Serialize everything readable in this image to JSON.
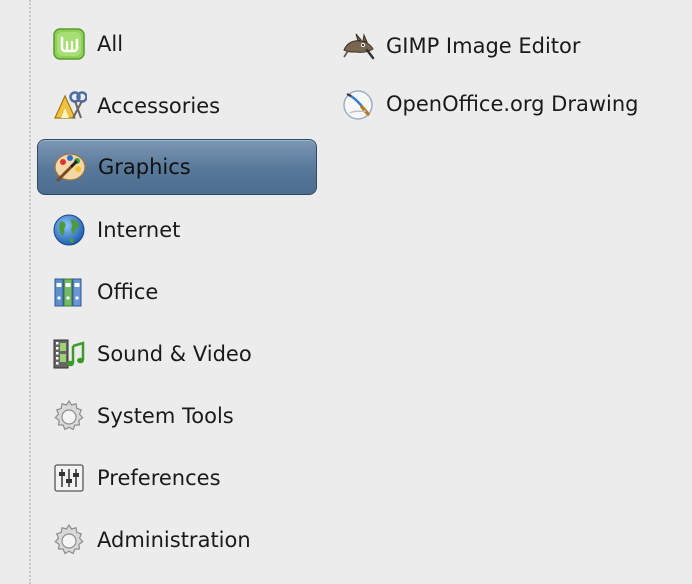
{
  "categories": [
    {
      "label": "All",
      "icon": "mint-logo-icon"
    },
    {
      "label": "Accessories",
      "icon": "accessories-icon"
    },
    {
      "label": "Graphics",
      "icon": "graphics-palette-icon",
      "selected": true
    },
    {
      "label": "Internet",
      "icon": "globe-icon"
    },
    {
      "label": "Office",
      "icon": "office-binders-icon"
    },
    {
      "label": "Sound & Video",
      "icon": "sound-video-icon"
    },
    {
      "label": "System Tools",
      "icon": "gear-icon"
    },
    {
      "label": "Preferences",
      "icon": "preferences-sliders-icon"
    },
    {
      "label": "Administration",
      "icon": "gear-icon"
    }
  ],
  "apps": [
    {
      "label": "GIMP Image Editor",
      "icon": "gimp-icon"
    },
    {
      "label": "OpenOffice.org Drawing",
      "icon": "draw-icon"
    }
  ],
  "colors": {
    "selected_gradient_top": "#7b98b4",
    "selected_gradient_bottom": "#4d6d8f",
    "background": "#ececec"
  }
}
